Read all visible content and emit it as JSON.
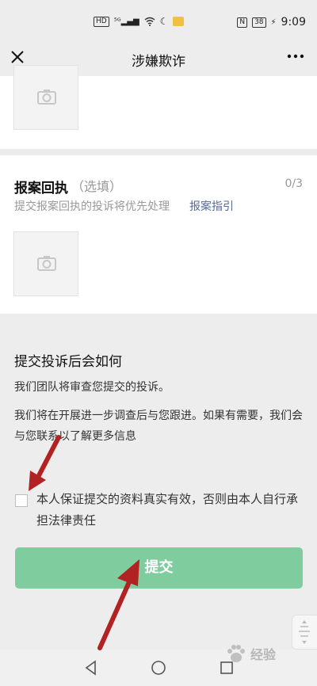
{
  "status_bar": {
    "icons": [
      "hd-icon",
      "signal-5g-icon",
      "wifi-icon",
      "moon-icon",
      "app-notification-icon"
    ],
    "nfc_icon": "nfc-icon",
    "battery": "38",
    "time": "9:09"
  },
  "header": {
    "close_icon": "close-icon",
    "title": "涉嫌欺诈",
    "more_icon": "more-icon"
  },
  "evidence_section": {
    "photo_icon": "camera-icon"
  },
  "receipt_section": {
    "title": "报案回执",
    "optional": "（选填）",
    "counter": "0/3",
    "hint": "提交报案回执的投诉将优先处理",
    "hint_link": "报案指引",
    "photo_icon": "camera-icon"
  },
  "info_section": {
    "title": "提交投诉后会如何",
    "para1": "我们团队将审查您提交的投诉。",
    "para2": "我们将在开展进一步调查后与您跟进。如果有需要，我们会与您联系以了解更多信息"
  },
  "agreement": {
    "checked": false,
    "text": "本人保证提交的资料真实有效，否则由本人自行承担法律责任"
  },
  "submit": {
    "label": "提交"
  },
  "watermark": {
    "text": "经验"
  },
  "colors": {
    "primary_green": "#7fcc9f",
    "link_blue": "#576b95",
    "annotation_red": "#b22222",
    "background": "#ededed"
  }
}
